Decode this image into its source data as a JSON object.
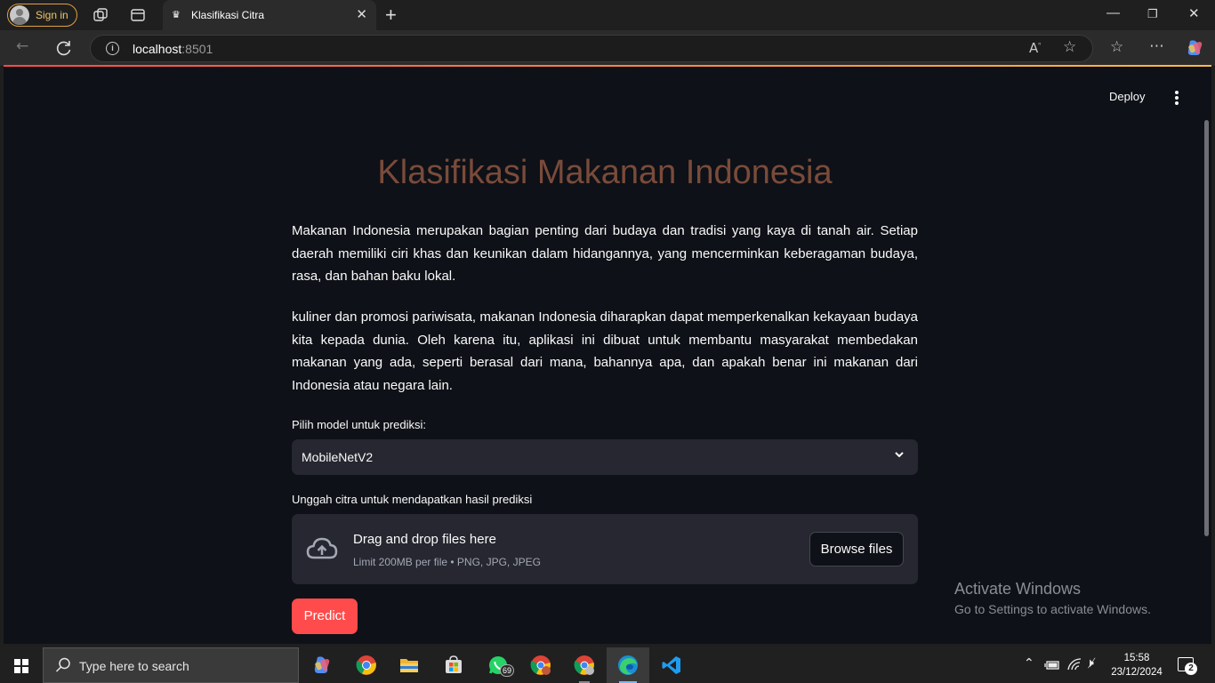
{
  "browser": {
    "signin_label": "Sign in",
    "tab_title": "Klasifikasi Citra",
    "url_host": "localhost",
    "url_port": ":8501"
  },
  "app": {
    "deploy_label": "Deploy",
    "title": "Klasifikasi Makanan Indonesia",
    "paragraph1": "Makanan Indonesia merupakan bagian penting dari budaya dan tradisi yang kaya di tanah air. Setiap daerah memiliki ciri khas dan keunikan dalam hidangannya, yang mencerminkan keberagaman budaya, rasa, dan bahan baku lokal.",
    "paragraph2": "kuliner dan promosi pariwisata, makanan Indonesia diharapkan dapat memperkenalkan kekayaan budaya kita kepada dunia. Oleh karena itu, aplikasi ini dibuat untuk membantu masyarakat membedakan makanan yang ada, seperti berasal dari mana, bahannya apa, dan apakah benar ini makanan dari Indonesia atau negara lain.",
    "model_label": "Pilih model untuk prediksi:",
    "model_selected": "MobileNetV2",
    "upload_label": "Unggah citra untuk mendapatkan hasil prediksi",
    "dropzone_title": "Drag and drop files here",
    "dropzone_hint": "Limit 200MB per file • PNG, JPG, JPEG",
    "browse_label": "Browse files",
    "predict_label": "Predict"
  },
  "watermark": {
    "line1": "Activate Windows",
    "line2": "Go to Settings to activate Windows."
  },
  "taskbar": {
    "search_placeholder": "Type here to search",
    "whatsapp_badge": "69",
    "time": "15:58",
    "date": "23/12/2024",
    "notifications": "2"
  }
}
